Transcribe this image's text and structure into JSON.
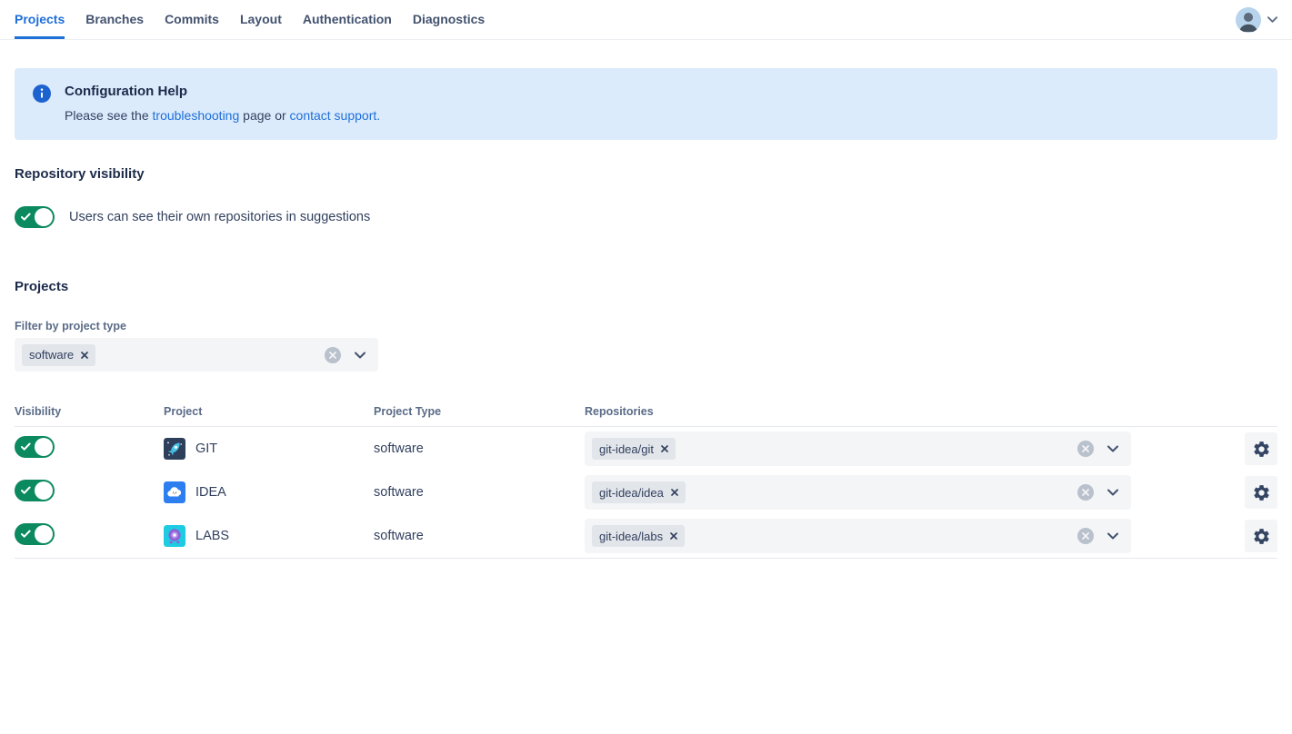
{
  "nav": {
    "tabs": [
      {
        "label": "Projects",
        "active": true
      },
      {
        "label": "Branches",
        "active": false
      },
      {
        "label": "Commits",
        "active": false
      },
      {
        "label": "Layout",
        "active": false
      },
      {
        "label": "Authentication",
        "active": false
      },
      {
        "label": "Diagnostics",
        "active": false
      }
    ],
    "user_menu": {
      "avatar_icon": "user-avatar",
      "chevron_icon": "chevron-down-icon"
    }
  },
  "banner": {
    "icon": "info-icon",
    "title": "Configuration Help",
    "message_prefix": "Please see the ",
    "link_troubleshooting": "troubleshooting",
    "message_middle": " page or ",
    "link_contact_support": "contact support."
  },
  "repository_visibility": {
    "heading": "Repository visibility",
    "toggle": {
      "state": "on",
      "label": "Users can see their own repositories in suggestions"
    }
  },
  "projects": {
    "heading": "Projects",
    "filter": {
      "label": "Filter by project type",
      "selected_tags": [
        "software"
      ]
    },
    "table": {
      "headers": [
        "Visibility",
        "Project",
        "Project Type",
        "Repositories"
      ],
      "rows": [
        {
          "visibility": "on",
          "icon": "rocket-project-icon",
          "name": "GIT",
          "type": "software",
          "repo_tags": [
            "git-idea/git"
          ]
        },
        {
          "visibility": "on",
          "icon": "cloud-project-icon",
          "name": "IDEA",
          "type": "software",
          "repo_tags": [
            "git-idea/idea"
          ]
        },
        {
          "visibility": "on",
          "icon": "robot-project-icon",
          "name": "LABS",
          "type": "software",
          "repo_tags": [
            "git-idea/labs"
          ]
        }
      ]
    }
  },
  "colors": {
    "accent_blue": "#1e6fd8",
    "link_blue": "#1e6fd8",
    "toggle_green": "#0b8a5f",
    "banner_bg": "#dcebfc",
    "banner_icon_blue": "#1d63cf",
    "select_bg": "#f4f5f7",
    "tag_bg": "#e2e5ea",
    "heading_text": "#1c2b4a",
    "body_text": "#32415f",
    "column_header_text": "#5a6b87",
    "git_icon_bg": "#2e3f5c",
    "idea_icon_bg": "#2d7ff0",
    "labs_icon_bg": "#1ecbe1"
  }
}
